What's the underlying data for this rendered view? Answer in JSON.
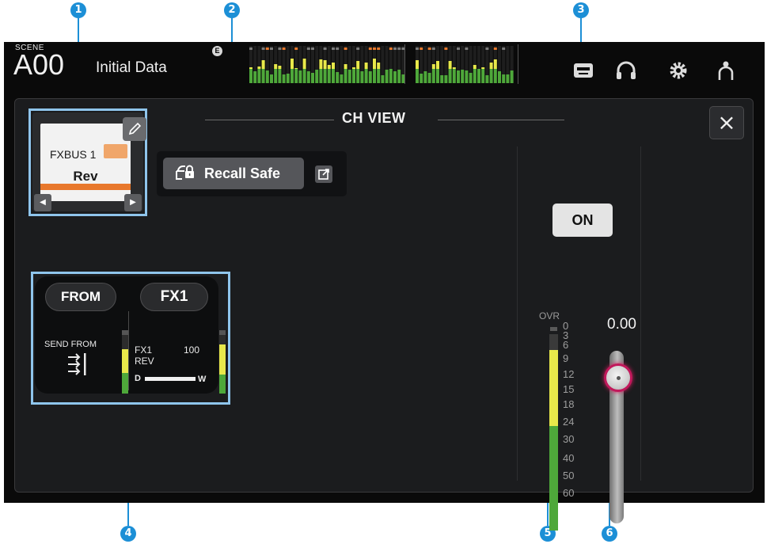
{
  "callouts": [
    "1",
    "2",
    "3",
    "4",
    "5",
    "6"
  ],
  "topbar": {
    "scene_label": "SCENE",
    "scene_number": "A00",
    "scene_title": "Initial Data",
    "edit_badge": "E",
    "icons": [
      "recorder-icon",
      "headphones-icon",
      "gear-icon",
      "user-icon"
    ]
  },
  "panel": {
    "title": "CH VIEW",
    "close_label": "×",
    "channel": {
      "bus_name": "FXBUS 1",
      "channel_name": "Rev",
      "color": "#e8782c"
    },
    "recall_safe_label": "Recall Safe",
    "io": {
      "from_label": "FROM",
      "fx_label": "FX1",
      "send_from_label": "SEND FROM",
      "fx_line1": "FX1",
      "fx_line2": "REV",
      "mix_value": "100",
      "mix_left": "D",
      "mix_right": "W"
    },
    "on_label": "ON",
    "fader_value": "0.00",
    "meter_ovr_label": "OVR",
    "meter_scale": [
      "0",
      "3",
      "6",
      "9",
      "12",
      "15",
      "18",
      "24",
      "30",
      "40",
      "50",
      "60"
    ]
  }
}
